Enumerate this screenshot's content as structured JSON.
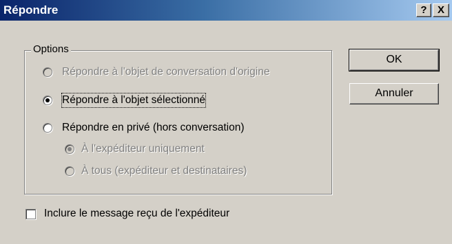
{
  "window": {
    "title": "Répondre",
    "help_label": "?",
    "close_label": "X"
  },
  "options_group": {
    "legend": "Options",
    "items": [
      {
        "label": "Répondre à l'objet de conversation d'origine",
        "selected": false,
        "enabled": false
      },
      {
        "label": "Répondre à l'objet sélectionné",
        "selected": true,
        "enabled": true
      },
      {
        "label": "Répondre en privé (hors conversation)",
        "selected": false,
        "enabled": true
      }
    ],
    "sub_items": [
      {
        "label": "À l'expéditeur uniquement",
        "selected": true,
        "enabled": false
      },
      {
        "label": "À tous (expéditeur et destinataires)",
        "selected": false,
        "enabled": false
      }
    ]
  },
  "include_checkbox": {
    "label": "Inclure le message reçu de l'expéditeur",
    "checked": false
  },
  "buttons": {
    "ok_label": "OK",
    "cancel_label": "Annuler"
  }
}
